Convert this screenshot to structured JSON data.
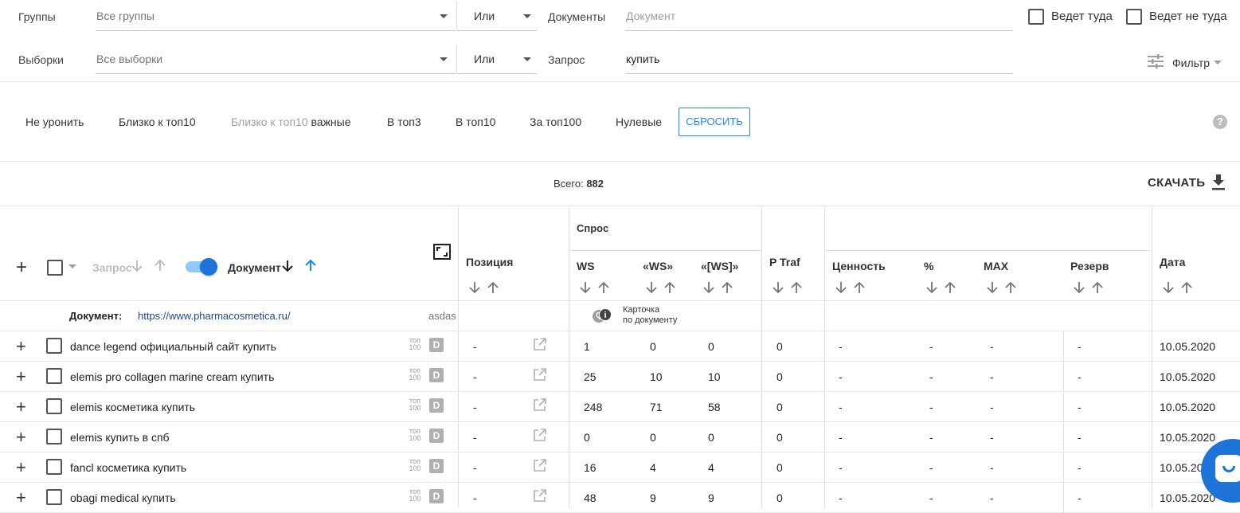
{
  "filters": {
    "groups_label": "Группы",
    "groups_value": "Все группы",
    "samples_label": "Выборки",
    "samples_value": "Все выборки",
    "or1": "Или",
    "or2": "Или",
    "documents_label": "Документы",
    "documents_placeholder": "Документ",
    "query_label": "Запрос",
    "query_value": "купить",
    "leads_there": "Ведет туда",
    "leads_not_there": "Ведет не туда",
    "filter_label": "Фильтр"
  },
  "quick_filters": {
    "items": [
      "Не уронить",
      "Близко к топ10",
      "В топ3",
      "В топ10",
      "За топ100",
      "Нулевые"
    ],
    "important_prefix": "Близко к топ10",
    "important_suffix": "важные",
    "reset": "СБРОСИТЬ"
  },
  "summary": {
    "total_label": "Всего:",
    "total_value": "882",
    "download": "СКАЧАТЬ"
  },
  "table": {
    "headers": {
      "query": "Запрос",
      "document": "Документ",
      "position": "Позиция",
      "demand": "Спрос",
      "ws": "WS",
      "qws": "«WS»",
      "bws": "«[WS]»",
      "ptraf": "P Traf",
      "value": "Ценность",
      "percent": "%",
      "max": "MAX",
      "reserve": "Резерв",
      "date": "Дата"
    },
    "doc_row": {
      "label": "Документ:",
      "url": "https://www.pharmacosmetica.ru/",
      "extra": "asdas",
      "card_line1": "Карточка",
      "card_line2": "по документу",
      "badge_q": "Q",
      "badge_i": "i"
    },
    "top_label_1": "топ",
    "top_label_2": "100",
    "d_badge": "D",
    "rows": [
      {
        "query": "dance legend официальный сайт купить",
        "pos": "-",
        "ws": "1",
        "qws": "0",
        "bws": "0",
        "ptraf": "0",
        "value": "-",
        "percent": "-",
        "max": "-",
        "reserve": "-",
        "date": "10.05.2020"
      },
      {
        "query": "elemis pro collagen marine cream купить",
        "pos": "-",
        "ws": "25",
        "qws": "10",
        "bws": "10",
        "ptraf": "0",
        "value": "-",
        "percent": "-",
        "max": "-",
        "reserve": "-",
        "date": "10.05.2020"
      },
      {
        "query": "elemis косметика купить",
        "pos": "-",
        "ws": "248",
        "qws": "71",
        "bws": "58",
        "ptraf": "0",
        "value": "-",
        "percent": "-",
        "max": "-",
        "reserve": "-",
        "date": "10.05.2020"
      },
      {
        "query": "elemis купить в спб",
        "pos": "-",
        "ws": "0",
        "qws": "0",
        "bws": "0",
        "ptraf": "0",
        "value": "-",
        "percent": "-",
        "max": "-",
        "reserve": "-",
        "date": "10.05.2020"
      },
      {
        "query": "fancl косметика купить",
        "pos": "-",
        "ws": "16",
        "qws": "4",
        "bws": "4",
        "ptraf": "0",
        "value": "-",
        "percent": "-",
        "max": "-",
        "reserve": "-",
        "date": "10.05.2020"
      },
      {
        "query": "obagi medical купить",
        "pos": "-",
        "ws": "48",
        "qws": "9",
        "bws": "9",
        "ptraf": "0",
        "value": "-",
        "percent": "-",
        "max": "-",
        "reserve": "-",
        "date": "10.05.2020"
      }
    ]
  }
}
